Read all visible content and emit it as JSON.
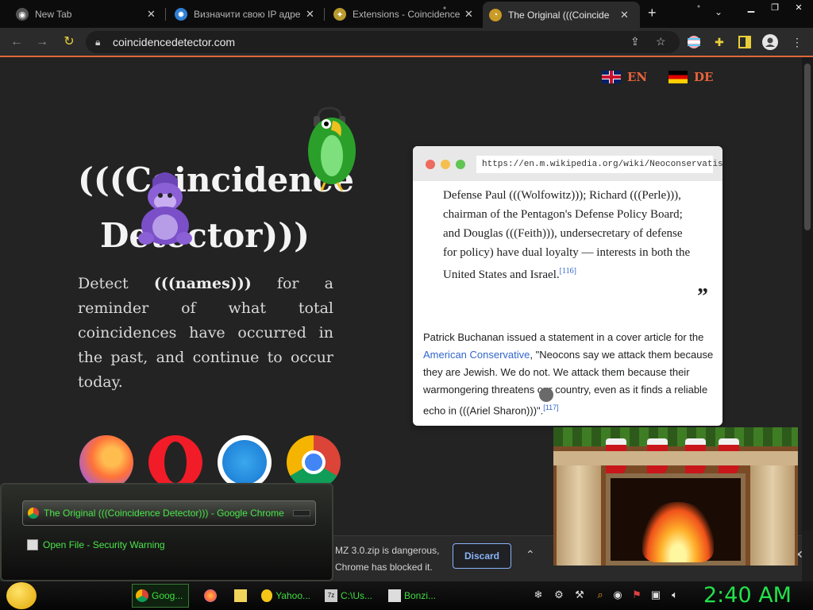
{
  "tabs": [
    {
      "title": "New Tab",
      "icon": "chrome-icon",
      "active": false
    },
    {
      "title": "Визначити свою IP адре",
      "icon": "ip-icon",
      "active": false
    },
    {
      "title": "Extensions - Coincidence",
      "icon": "puzzle-icon",
      "active": false
    },
    {
      "title": "The Original (((Coincide",
      "icon": "coincidence-icon",
      "active": true
    }
  ],
  "address": {
    "url": "coincidencedetector.com"
  },
  "page": {
    "lang_en": "EN",
    "lang_de": "DE",
    "title_line1": "(((Coincidence",
    "title_line2": "Detector)))",
    "desc_pre": "Detect ",
    "desc_bold": "(((names)))",
    "desc_post": " for a reminder of what total coincidences have occurred in the past, and continue to occur today."
  },
  "card": {
    "url": "https://en.m.wikipedia.org/wiki/Neoconservatism",
    "quote": "Defense Paul (((Wolfowitz))); Richard (((Perle))), chairman of the Pentagon's Defense Policy Board; and Douglas (((Feith))), undersecretary of defense for policy) have dual loyalty — interests in both the United States and Israel.",
    "quote_ref": "[116]",
    "quote_mark": "”",
    "para_pre": "Patrick Buchanan issued a statement in a cover article for the ",
    "para_link": "American Conservative",
    "para_post": ", \"Neocons say we attack them because they are Jewish. We do not. We attack them because their warmongering threatens our country, even as it finds a reliable echo in (((Ariel Sharon)))\".",
    "para_ref": "[117]"
  },
  "download": {
    "line1": "MZ 3.0.zip is dangerous,",
    "line2": "Chrome has blocked it.",
    "discard": "Discard"
  },
  "switcher": {
    "items": [
      {
        "label": "The Original (((Coincidence Detector))) - Google Chrome"
      },
      {
        "label": "Open File - Security Warning"
      }
    ]
  },
  "taskbar": {
    "items": [
      {
        "label": "Goog..."
      },
      {
        "label": ""
      },
      {
        "label": ""
      },
      {
        "label": "Yahoo..."
      },
      {
        "label": "C:\\Us..."
      },
      {
        "label": "Bonzi..."
      }
    ],
    "clock": "2:40 AM"
  },
  "colors": {
    "accent": "#e8633c",
    "taskbar_text": "#3fdc3f",
    "clock": "#22e24a",
    "link": "#3366cc"
  }
}
